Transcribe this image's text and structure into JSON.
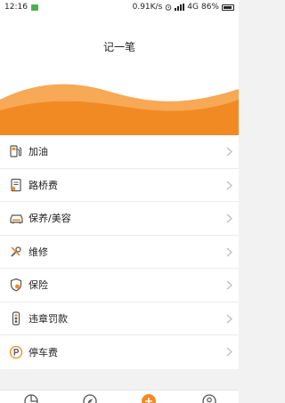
{
  "status": {
    "time": "12:16",
    "speed": "0.91K/s",
    "network": "4G",
    "battery": "86%"
  },
  "header": {
    "title": "记一笔"
  },
  "menu": [
    {
      "label": "加油",
      "icon": "fuel-pump-icon"
    },
    {
      "label": "路桥费",
      "icon": "toll-receipt-icon"
    },
    {
      "label": "保养/美容",
      "icon": "car-icon"
    },
    {
      "label": "维修",
      "icon": "wrench-screwdriver-icon"
    },
    {
      "label": "保险",
      "icon": "shield-icon"
    },
    {
      "label": "违章罚款",
      "icon": "traffic-light-icon"
    },
    {
      "label": "停车费",
      "icon": "parking-icon"
    }
  ],
  "tabs": [
    {
      "icon": "pie-chart-icon"
    },
    {
      "icon": "compass-icon"
    },
    {
      "icon": "add-record-icon"
    },
    {
      "icon": "profile-icon"
    }
  ],
  "colors": {
    "accent": "#F28A24",
    "accent_light": "#F7A955",
    "icon": "#555555",
    "chevron": "#BBBBBB"
  }
}
